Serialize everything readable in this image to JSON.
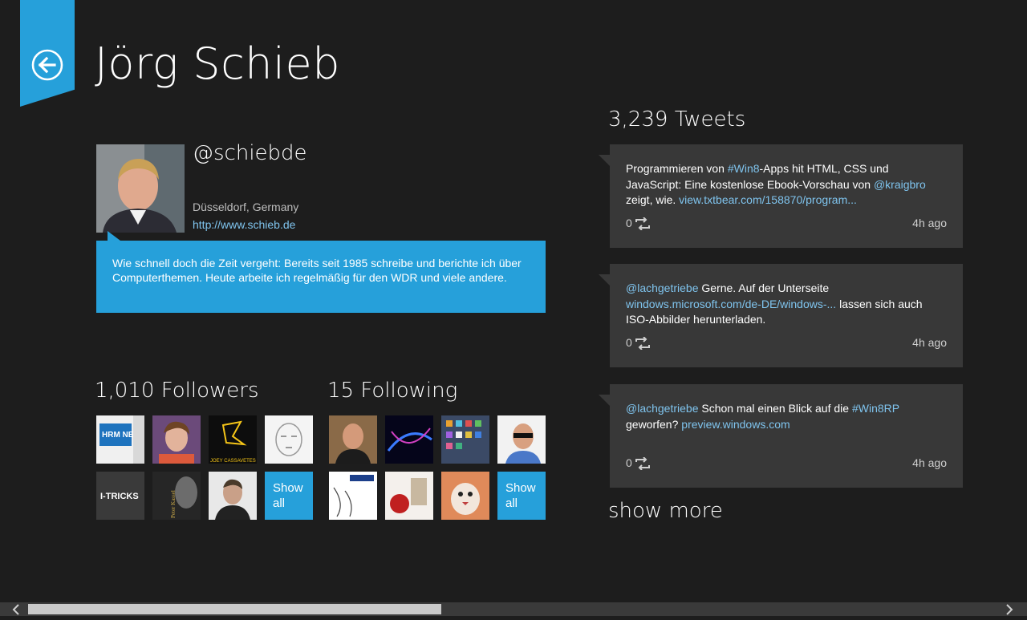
{
  "profile": {
    "name": "Jörg Schieb",
    "handle": "@schiebde",
    "location": "Düsseldorf, Germany",
    "website": "http://www.schieb.de",
    "bio": "Wie schnell doch die Zeit vergeht: Bereits seit 1985 schreibe und berichte ich über Computerthemen. Heute arbeite ich regelmäßig für den WDR und viele andere."
  },
  "followers": {
    "title": "1,010 Followers",
    "show_all": "Show all",
    "thumbs": [
      {
        "label": "HRM NEWS"
      },
      {
        "label": ""
      },
      {
        "label": "JOEY CASSAVETES"
      },
      {
        "label": ""
      },
      {
        "label": "I-TRICKS"
      },
      {
        "label": "Peter Kassel"
      },
      {
        "label": ""
      }
    ]
  },
  "following": {
    "title": "15 Following",
    "show_all": "Show all"
  },
  "tweets": {
    "title": "3,239 Tweets",
    "show_more": "show more",
    "items": [
      {
        "parts": [
          {
            "text": "Programmieren von "
          },
          {
            "text": "#Win8",
            "link": true
          },
          {
            "text": "-Apps hit HTML, CSS und JavaScript: Eine kostenlose Ebook-Vorschau von "
          },
          {
            "text": "@kraigbro",
            "link": true
          },
          {
            "text": " zeigt, wie. "
          },
          {
            "text": "view.txtbear.com/158870/program...",
            "link": true
          }
        ],
        "retweets": "0",
        "time": "4h ago"
      },
      {
        "parts": [
          {
            "text": "@lachgetriebe",
            "link": true
          },
          {
            "text": " Gerne. Auf der Unterseite "
          },
          {
            "text": "windows.microsoft.com/de-DE/windows-...",
            "link": true
          },
          {
            "text": " lassen sich auch ISO-Abbilder herunterladen."
          }
        ],
        "retweets": "0",
        "time": "4h ago"
      },
      {
        "parts": [
          {
            "text": "@lachgetriebe",
            "link": true
          },
          {
            "text": " Schon mal einen Blick auf die "
          },
          {
            "text": "#Win8RP",
            "link": true
          },
          {
            "text": " geworfen? "
          },
          {
            "text": "preview.windows.com",
            "link": true
          }
        ],
        "retweets": "0",
        "time": "4h ago"
      }
    ]
  },
  "colors": {
    "accent": "#26a0da",
    "background": "#1d1d1d",
    "card": "#383838",
    "link": "#7fc4ee"
  },
  "icons": {
    "back": "back-arrow-icon",
    "retweet": "retweet-icon",
    "scroll_left": "chevron-left-icon",
    "scroll_right": "chevron-right-icon"
  }
}
